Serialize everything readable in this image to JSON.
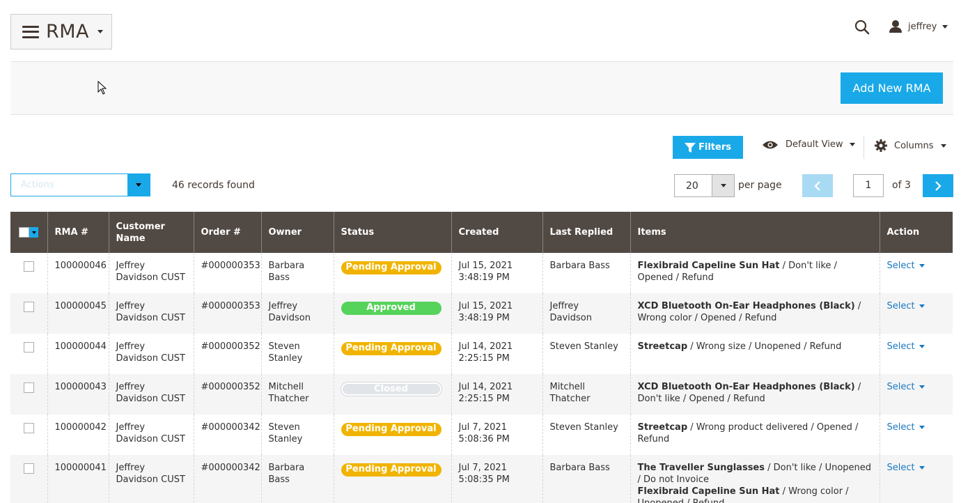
{
  "header": {
    "title": "RMA",
    "user_name": "jeffrey"
  },
  "page_actions": {
    "add_button": "Add New RMA"
  },
  "toolbar": {
    "filters_label": "Filters",
    "view_label": "Default View",
    "columns_label": "Columns",
    "actions_placeholder": "Actions",
    "records_found": "46 records found",
    "per_page_value": "20",
    "per_page_label": "per page",
    "current_page": "1",
    "of_pages": "of 3"
  },
  "table": {
    "columns": [
      "RMA #",
      "Customer Name",
      "Order #",
      "Owner",
      "Status",
      "Created",
      "Last Replied",
      "Items",
      "Action"
    ],
    "rows": [
      {
        "rma": "100000046",
        "customer": "Jeffrey Davidson CUST",
        "order": "#000000353",
        "owner": "Barbara Bass",
        "status": "Pending Approval",
        "status_type": "pending",
        "created": "Jul 15, 2021 3:48:19 PM",
        "last_replied": "Barbara Bass",
        "items": [
          {
            "name": "Flexibraid Capeline Sun Hat",
            "details": " / Don't like / Opened / Refund"
          }
        ],
        "action": "Select"
      },
      {
        "rma": "100000045",
        "customer": "Jeffrey Davidson CUST",
        "order": "#000000353",
        "owner": "Jeffrey Davidson",
        "status": "Approved",
        "status_type": "approved",
        "created": "Jul 15, 2021 3:48:19 PM",
        "last_replied": "Jeffrey Davidson",
        "items": [
          {
            "name": "XCD Bluetooth On-Ear Headphones (Black)",
            "details": " / Wrong color / Opened / Refund"
          }
        ],
        "action": "Select"
      },
      {
        "rma": "100000044",
        "customer": "Jeffrey Davidson CUST",
        "order": "#000000352",
        "owner": "Steven Stanley",
        "status": "Pending Approval",
        "status_type": "pending",
        "created": "Jul 14, 2021 2:25:15 PM",
        "last_replied": "Steven Stanley",
        "items": [
          {
            "name": "Streetcap",
            "details": " / Wrong size / Unopened / Refund"
          }
        ],
        "action": "Select"
      },
      {
        "rma": "100000043",
        "customer": "Jeffrey Davidson CUST",
        "order": "#000000352",
        "owner": "Mitchell Thatcher",
        "status": "Closed",
        "status_type": "closed",
        "created": "Jul 14, 2021 2:25:15 PM",
        "last_replied": "Mitchell Thatcher",
        "items": [
          {
            "name": "XCD Bluetooth On-Ear Headphones (Black)",
            "details": " / Don't like / Opened / Refund"
          }
        ],
        "action": "Select"
      },
      {
        "rma": "100000042",
        "customer": "Jeffrey Davidson CUST",
        "order": "#000000342",
        "owner": "Steven Stanley",
        "status": "Pending Approval",
        "status_type": "pending",
        "created": "Jul 7, 2021 5:08:36 PM",
        "last_replied": "Steven Stanley",
        "items": [
          {
            "name": "Streetcap",
            "details": " / Wrong product delivered / Opened / Refund"
          }
        ],
        "action": "Select"
      },
      {
        "rma": "100000041",
        "customer": "Jeffrey Davidson CUST",
        "order": "#000000342",
        "owner": "Barbara Bass",
        "status": "Pending Approval",
        "status_type": "pending",
        "created": "Jul 7, 2021 5:08:35 PM",
        "last_replied": "Barbara Bass",
        "items": [
          {
            "name": "The Traveller Sunglasses",
            "details": " / Don't like / Unopened / Do not Invoice"
          },
          {
            "name": "Flexibraid Capeline Sun Hat",
            "details": " / Wrong color / Unopened / Refund"
          }
        ],
        "action": "Select"
      }
    ]
  },
  "colors": {
    "accent": "#1aa9e8",
    "header_bg": "#514943",
    "pending": "#f0b400",
    "approved": "#56d35a",
    "closed": "#e1e4e8",
    "link": "#1979c3"
  }
}
